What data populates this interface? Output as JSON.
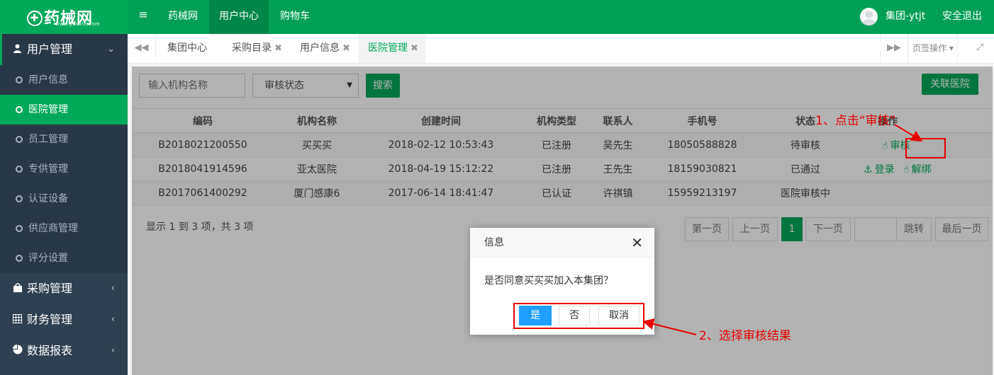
{
  "brand": {
    "name": "药械网",
    "url": "www.yooxie.com"
  },
  "topnav": {
    "items": [
      {
        "label": "药械网"
      },
      {
        "label": "用户中心"
      },
      {
        "label": "购物车"
      }
    ],
    "user_name": "集团-ytjt",
    "logout": "安全退出"
  },
  "sidebar": {
    "user_group": "用户管理",
    "sub_items": [
      {
        "label": "用户信息"
      },
      {
        "label": "医院管理"
      },
      {
        "label": "员工管理"
      },
      {
        "label": "专供管理"
      },
      {
        "label": "认证设备"
      },
      {
        "label": "供应商管理"
      },
      {
        "label": "评分设置"
      }
    ],
    "other_groups": [
      {
        "label": "采购管理",
        "icon": "shopping-bag-icon"
      },
      {
        "label": "财务管理",
        "icon": "calculator-icon"
      },
      {
        "label": "数据报表",
        "icon": "pie-chart-icon"
      }
    ]
  },
  "tabs": {
    "items": [
      {
        "label": "集团中心",
        "closable": false
      },
      {
        "label": "采购目录",
        "closable": true
      },
      {
        "label": "用户信息",
        "closable": true
      },
      {
        "label": "医院管理",
        "closable": true
      }
    ],
    "ops_label": "页签操作"
  },
  "toolbar": {
    "search_placeholder": "输入机构名称",
    "status_select": "审核状态",
    "search_button": "搜索",
    "link_button": "关联医院"
  },
  "table": {
    "headers": [
      "编码",
      "机构名称",
      "创建时间",
      "机构类型",
      "联系人",
      "手机号",
      "状态",
      "操作"
    ],
    "rows": [
      {
        "code": "B2018021200550",
        "name": "买买买",
        "created": "2018-02-12 10:53:43",
        "type": "已注册",
        "contact": "吴先生",
        "phone": "18050588828",
        "status": "待审核",
        "actions": [
          "审核"
        ]
      },
      {
        "code": "B2018041914596",
        "name": "亚太医院",
        "created": "2018-04-19 15:12:22",
        "type": "已注册",
        "contact": "王先生",
        "phone": "18159030821",
        "status": "已通过",
        "actions": [
          "登录",
          "解绑"
        ]
      },
      {
        "code": "B2017061400292",
        "name": "厦门感康6",
        "created": "2017-06-14 18:41:47",
        "type": "已认证",
        "contact": "许祺镇",
        "phone": "15959213197",
        "status": "医院审核中",
        "actions": []
      }
    ]
  },
  "pagination": {
    "summary": "显示 1 到 3 项，共 3 项",
    "first": "第一页",
    "prev": "上一页",
    "current": "1",
    "next": "下一页",
    "jump": "跳转",
    "last": "最后一页"
  },
  "dialog": {
    "title": "信息",
    "message": "是否同意买买买加入本集团？",
    "yes": "是",
    "no": "否",
    "cancel": "取消"
  },
  "annotations": {
    "step1": "1、点击“审核”",
    "step2": "2、选择审核结果"
  },
  "colors": {
    "accent": "#00a85a",
    "sidebar": "#2f4050",
    "dialog_primary": "#1e9fff",
    "annotation": "#e60000"
  }
}
